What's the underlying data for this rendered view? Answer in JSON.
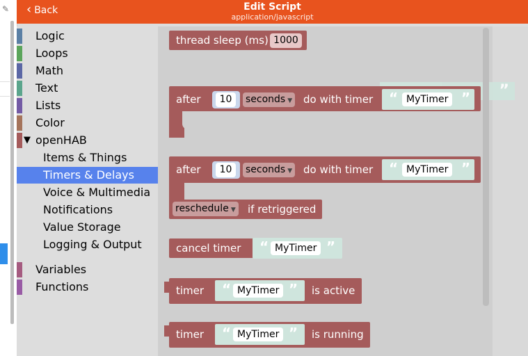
{
  "header": {
    "back_label": "Back",
    "title": "Edit Script",
    "subtitle": "application/javascript",
    "background": "#e8531e"
  },
  "toolbox": {
    "categories": [
      {
        "label": "Logic",
        "color": "#5b80a5"
      },
      {
        "label": "Loops",
        "color": "#5ba55b"
      },
      {
        "label": "Math",
        "color": "#5b67a5"
      },
      {
        "label": "Text",
        "color": "#5ba58c"
      },
      {
        "label": "Lists",
        "color": "#745ba5"
      },
      {
        "label": "Color",
        "color": "#a5745b"
      },
      {
        "label": "openHAB",
        "color": "#a55b5b"
      }
    ],
    "openhab_subcategories": [
      {
        "label": "Items & Things"
      },
      {
        "label": "Timers & Delays"
      },
      {
        "label": "Voice & Multimedia"
      },
      {
        "label": "Notifications"
      },
      {
        "label": "Value Storage"
      },
      {
        "label": "Logging & Output"
      }
    ],
    "selected": "Timers & Delays",
    "extra_categories": [
      {
        "label": "Variables",
        "color": "#a55b80"
      },
      {
        "label": "Functions",
        "color": "#995ba5"
      }
    ]
  },
  "blocks": {
    "thread_sleep": {
      "label": "thread sleep (ms)",
      "value": "1000"
    },
    "after1": {
      "after": "after",
      "value": "10",
      "unit": "seconds",
      "do_with_timer": "do with timer",
      "timer_name": "MyTimer"
    },
    "after2": {
      "after": "after",
      "value": "10",
      "unit": "seconds",
      "do_with_timer": "do with timer",
      "timer_name": "MyTimer",
      "mode": "reschedule",
      "if_retriggered": "if retriggered"
    },
    "cancel_timer": {
      "label": "cancel timer",
      "timer_name": "MyTimer"
    },
    "timer_active": {
      "timer": "timer",
      "timer_name": "MyTimer",
      "state": "is active"
    },
    "timer_running": {
      "timer": "timer",
      "timer_name": "MyTimer",
      "state": "is running"
    },
    "quote_open": "“",
    "quote_close": "”",
    "block_color": "#a55b5b",
    "string_color": "#cfe5dd"
  }
}
